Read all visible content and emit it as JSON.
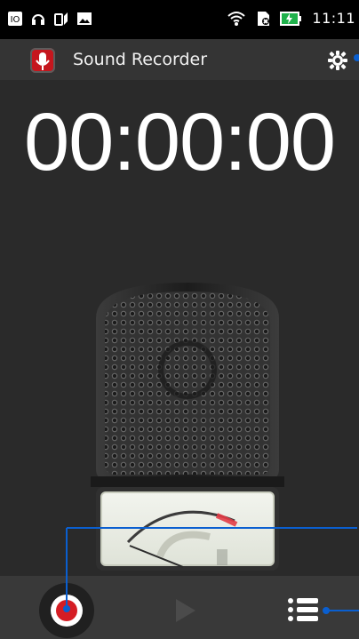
{
  "status": {
    "time": "11:11"
  },
  "app": {
    "title": "Sound Recorder"
  },
  "timer": {
    "value": "00:00:00"
  },
  "colors": {
    "accent": "#0a5fd0",
    "record_red": "#d51d24",
    "app_icon_red": "#c5161d"
  },
  "icons": {
    "status": [
      "photo-icon",
      "headphones-icon",
      "battery-alt-icon",
      "image-icon"
    ],
    "settings": "gear-icon",
    "record": "record-icon",
    "play": "play-icon",
    "list": "list-icon",
    "wifi": "wifi-icon",
    "sim": "sim-card-icon",
    "battery": "battery-icon"
  }
}
